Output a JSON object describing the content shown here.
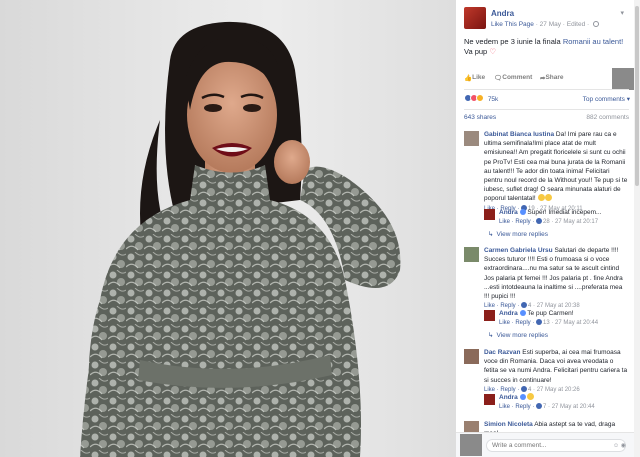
{
  "post": {
    "page_name": "Andra",
    "like_link": "Like This Page",
    "meta": "· 27 May · Edited ·",
    "text_before": "Ne vedem pe 3 iunie la finala ",
    "text_tag": "Romanii au talent!",
    "text_after": " Va pup",
    "text_emoji": "♡"
  },
  "actions": {
    "like": "Like",
    "comment": "Comment",
    "share": "Share"
  },
  "reactions": {
    "count": "75k",
    "top_comments": "Top comments ▾"
  },
  "stats": {
    "shares": "643 shares",
    "comments": "882 comments"
  },
  "comments": [
    {
      "name": "Gabinat Bianca Iustina",
      "text": " Da! Imi pare rau ca e ultima semifinala!Imi place atat de mult emisiunea!! Am pregatit floricelele si sunt cu ochii pe ProTv! Esti cea mai buna jurata de la Romanii au talent!!! Te ador din toata inima! Felicitari pentru noul record de la Without you!! Te pup si te iubesc, suflet drag! O seara minunata alaturi de poporul talentatal!",
      "foot_links": "Like · Reply · ",
      "likes": "19",
      "date": " · 27 May at 20:11"
    },
    {
      "name": "Andra",
      "text": " Super! Imediat incepem...",
      "foot_links": "Like · Reply · ",
      "likes": "28",
      "date": " · 27 May at 20:17"
    },
    {
      "name": "Carmen Gabriela Ursu",
      "text": " Salutari de departe !!!! Succes tuturor !!!! Esti o frumoasa si o voce extraordinara....nu ma satur sa te ascult cintind Jos palaria pt femei !!! Jos palaria pt . fine Andra ...esti intotdeauna la inaltime si ....preferata mea !!! pupici !!!",
      "foot_links": "Like · Reply · ",
      "likes": "4",
      "date": " · 27 May at 20:38"
    },
    {
      "name": "Andra",
      "text": " Te pup Carmen!",
      "foot_links": "Like · Reply · ",
      "likes": "13",
      "date": " · 27 May at 20:44"
    },
    {
      "name": "Dac Razvan",
      "text": " Esti superba, ai cea mai frumoasa voce din Romania. Daca voi avea vreodata o fetita se va numi Andra. Felicitari pentru cariera ta si succes in continuare!",
      "foot_links": "Like · Reply · ",
      "likes": "4",
      "date": " · 27 May at 20:26"
    },
    {
      "name": "Andra",
      "text": "",
      "foot_links": "Like · Reply · ",
      "likes": "7",
      "date": " · 27 May at 20:44"
    },
    {
      "name": "Simion Nicoleta",
      "text": " Abia astept sa te vad, draga mea!"
    }
  ],
  "view_more_replies": "View more replies",
  "composer": {
    "placeholder": "Write a comment..."
  },
  "colors": {
    "fb_blue": "#3b5998",
    "dress": "#6c7169"
  }
}
